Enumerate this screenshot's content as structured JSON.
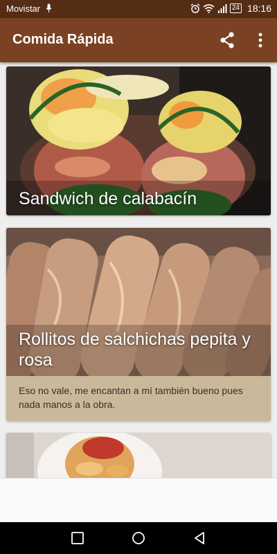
{
  "status_bar": {
    "carrier": "Movistar",
    "battery": "24",
    "time": "18:16",
    "icons": [
      "mic-icon",
      "alarm-icon",
      "wifi-icon",
      "signal-icon",
      "battery-icon"
    ]
  },
  "app_bar": {
    "title": "Comida Rápida",
    "actions": [
      "share-icon",
      "more-vert-icon"
    ]
  },
  "cards": [
    {
      "title": "Sandwich de calabacín",
      "description": ""
    },
    {
      "title": "Rollitos de salchichas pepita y rosa",
      "description": "Eso no vale, me encantan a mí también bueno pues nada manos a la obra."
    },
    {
      "title": "",
      "description": ""
    }
  ],
  "nav_bar": {
    "buttons": [
      "recents-icon",
      "home-icon",
      "back-icon"
    ]
  },
  "colors": {
    "status_bar": "#552c14",
    "app_bar": "#7a4222",
    "description_bg": "#c9b89a"
  }
}
